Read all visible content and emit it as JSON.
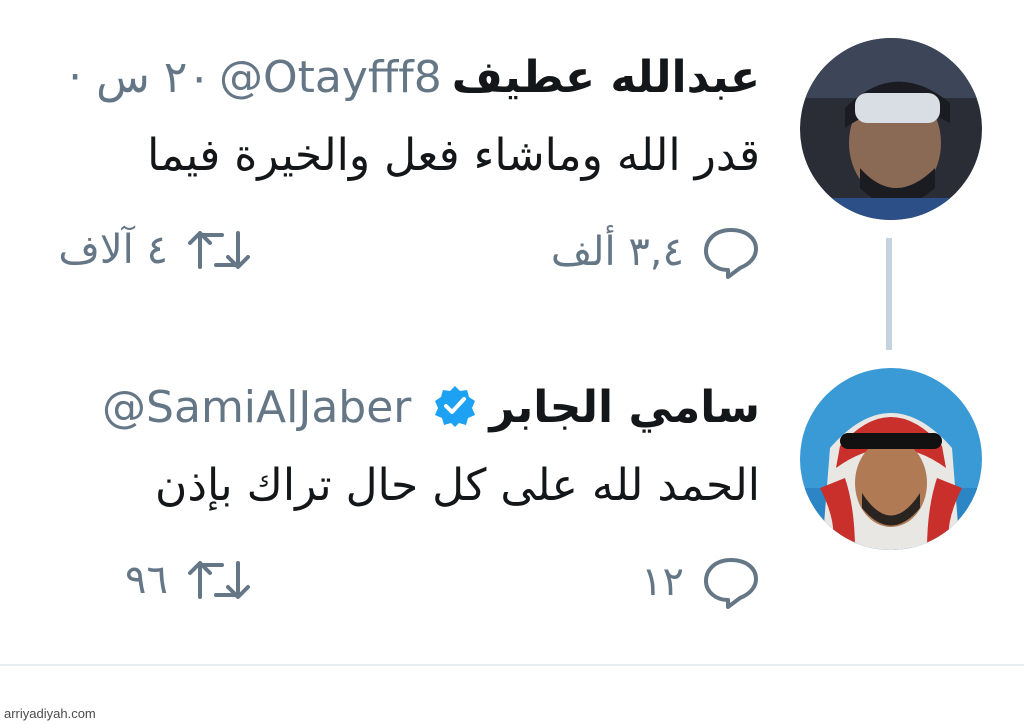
{
  "tweets": [
    {
      "name": "عبدالله عطيف",
      "handle": "@Otayfff8",
      "date": "· ٢٠ س",
      "text": "قدر الله وماشاء فعل والخيرة فيما",
      "replies": "٣,٤ ألف",
      "retweets": "٤ آلاف"
    },
    {
      "name": "سامي الجابر",
      "handle": "@SamiAlJaber",
      "verified": true,
      "text": "الحمد لله على كل حال تراك بإذن",
      "replies": "١٢",
      "retweets": "٩٦"
    }
  ],
  "colors": {
    "accent": "#1da1f2",
    "muted": "#657786",
    "thread": "#c4d3de"
  },
  "icons": [
    "reply-icon",
    "retweet-icon",
    "verified-badge-icon"
  ],
  "watermark": "arriyadiyah.com"
}
